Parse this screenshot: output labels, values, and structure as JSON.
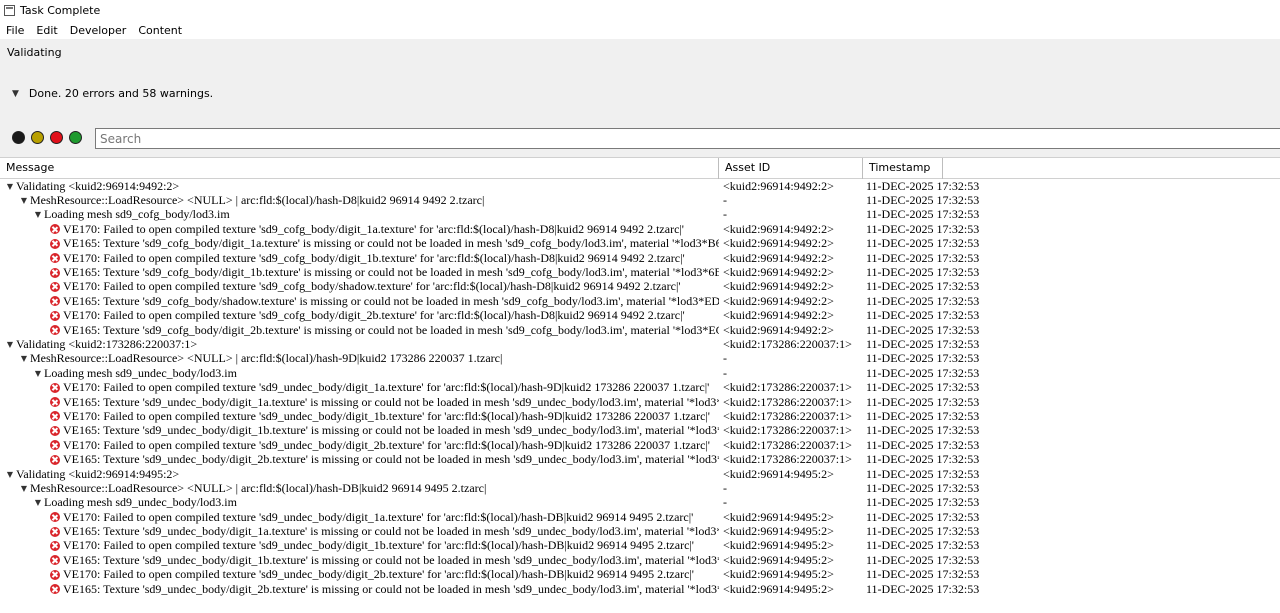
{
  "window": {
    "title": "Task Complete"
  },
  "menu": [
    "File",
    "Edit",
    "Developer",
    "Content"
  ],
  "status": {
    "label": "Validating",
    "summary": "Done. 20 errors and 58 warnings."
  },
  "filters": {
    "colors": [
      "#1a1a1a",
      "#b8a000",
      "#e0101a",
      "#1e9a2e"
    ],
    "search_placeholder": "Search"
  },
  "columns": {
    "message": "Message",
    "asset_id": "Asset ID",
    "timestamp": "Timestamp"
  },
  "rows": [
    {
      "level": 0,
      "type": "group",
      "message": "Validating <kuid2:96914:9492:2>",
      "asset": "<kuid2:96914:9492:2>",
      "time": "11-DEC-2025 17:32:53"
    },
    {
      "level": 1,
      "type": "group",
      "message": "MeshResource::LoadResource> <NULL> | arc:fld:$(local)/hash-D8|kuid2 96914 9492 2.tzarc|",
      "asset": "-",
      "time": "11-DEC-2025 17:32:53"
    },
    {
      "level": 2,
      "type": "group",
      "message": "Loading mesh sd9_cofg_body/lod3.im",
      "asset": "-",
      "time": "11-DEC-2025 17:32:53"
    },
    {
      "level": 3,
      "type": "error",
      "message": "VE170: Failed to open compiled texture 'sd9_cofg_body/digit_1a.texture' for 'arc:fld:$(local)/hash-D8|kuid2 96914 9492 2.tzarc|'",
      "asset": "<kuid2:96914:9492:2>",
      "time": "11-DEC-2025 17:32:53"
    },
    {
      "level": 3,
      "type": "error",
      "message": "VE165: Texture 'sd9_cofg_body/digit_1a.texture' is missing or could not be loaded in mesh 'sd9_cofg_body/lod3.im', material '*lod3*B64F0BB1*m...",
      "asset": "<kuid2:96914:9492:2>",
      "time": "11-DEC-2025 17:32:53"
    },
    {
      "level": 3,
      "type": "error",
      "message": "VE170: Failed to open compiled texture 'sd9_cofg_body/digit_1b.texture' for 'arc:fld:$(local)/hash-D8|kuid2 96914 9492 2.tzarc|'",
      "asset": "<kuid2:96914:9492:2>",
      "time": "11-DEC-2025 17:32:53"
    },
    {
      "level": 3,
      "type": "error",
      "message": "VE165: Texture 'sd9_cofg_body/digit_1b.texture' is missing or could not be loaded in mesh 'sd9_cofg_body/lod3.im', material '*lod3*6B0DFE96*m...",
      "asset": "<kuid2:96914:9492:2>",
      "time": "11-DEC-2025 17:32:53"
    },
    {
      "level": 3,
      "type": "error",
      "message": "VE170: Failed to open compiled texture 'sd9_cofg_body/shadow.texture' for 'arc:fld:$(local)/hash-D8|kuid2 96914 9492 2.tzarc|'",
      "asset": "<kuid2:96914:9492:2>",
      "time": "11-DEC-2025 17:32:53"
    },
    {
      "level": 3,
      "type": "error",
      "message": "VE165: Texture 'sd9_cofg_body/shadow.texture' is missing or could not be loaded in mesh 'sd9_cofg_body/lod3.im', material '*lod3*ED2D3077*mt...",
      "asset": "<kuid2:96914:9492:2>",
      "time": "11-DEC-2025 17:32:53"
    },
    {
      "level": 3,
      "type": "error",
      "message": "VE170: Failed to open compiled texture 'sd9_cofg_body/digit_2b.texture' for 'arc:fld:$(local)/hash-D8|kuid2 96914 9492 2.tzarc|'",
      "asset": "<kuid2:96914:9492:2>",
      "time": "11-DEC-2025 17:32:53"
    },
    {
      "level": 3,
      "type": "error",
      "message": "VE165: Texture 'sd9_cofg_body/digit_2b.texture' is missing or could not be loaded in mesh 'sd9_cofg_body/lod3.im', material '*lod3*EC942D3D*m...",
      "asset": "<kuid2:96914:9492:2>",
      "time": "11-DEC-2025 17:32:53"
    },
    {
      "level": 0,
      "type": "group",
      "message": "Validating <kuid2:173286:220037:1>",
      "asset": "<kuid2:173286:220037:1>",
      "time": "11-DEC-2025 17:32:53"
    },
    {
      "level": 1,
      "type": "group",
      "message": "MeshResource::LoadResource> <NULL> | arc:fld:$(local)/hash-9D|kuid2 173286 220037 1.tzarc|",
      "asset": "-",
      "time": "11-DEC-2025 17:32:53"
    },
    {
      "level": 2,
      "type": "group",
      "message": "Loading mesh sd9_undec_body/lod3.im",
      "asset": "-",
      "time": "11-DEC-2025 17:32:53"
    },
    {
      "level": 3,
      "type": "error",
      "message": "VE170: Failed to open compiled texture 'sd9_undec_body/digit_1a.texture' for 'arc:fld:$(local)/hash-9D|kuid2 173286 220037 1.tzarc|'",
      "asset": "<kuid2:173286:220037:1>",
      "time": "11-DEC-2025 17:32:53"
    },
    {
      "level": 3,
      "type": "error",
      "message": "VE165: Texture 'sd9_undec_body/digit_1a.texture' is missing or could not be loaded in mesh 'sd9_undec_body/lod3.im', material '*lod3*B64F0BB1...",
      "asset": "<kuid2:173286:220037:1>",
      "time": "11-DEC-2025 17:32:53"
    },
    {
      "level": 3,
      "type": "error",
      "message": "VE170: Failed to open compiled texture 'sd9_undec_body/digit_1b.texture' for 'arc:fld:$(local)/hash-9D|kuid2 173286 220037 1.tzarc|'",
      "asset": "<kuid2:173286:220037:1>",
      "time": "11-DEC-2025 17:32:53"
    },
    {
      "level": 3,
      "type": "error",
      "message": "VE165: Texture 'sd9_undec_body/digit_1b.texture' is missing or could not be loaded in mesh 'sd9_undec_body/lod3.im', material '*lod3*6B0DFE96...",
      "asset": "<kuid2:173286:220037:1>",
      "time": "11-DEC-2025 17:32:53"
    },
    {
      "level": 3,
      "type": "error",
      "message": "VE170: Failed to open compiled texture 'sd9_undec_body/digit_2b.texture' for 'arc:fld:$(local)/hash-9D|kuid2 173286 220037 1.tzarc|'",
      "asset": "<kuid2:173286:220037:1>",
      "time": "11-DEC-2025 17:32:53"
    },
    {
      "level": 3,
      "type": "error",
      "message": "VE165: Texture 'sd9_undec_body/digit_2b.texture' is missing or could not be loaded in mesh 'sd9_undec_body/lod3.im', material '*lod3*EC942D3...",
      "asset": "<kuid2:173286:220037:1>",
      "time": "11-DEC-2025 17:32:53"
    },
    {
      "level": 0,
      "type": "group",
      "message": "Validating <kuid2:96914:9495:2>",
      "asset": "<kuid2:96914:9495:2>",
      "time": "11-DEC-2025 17:32:53"
    },
    {
      "level": 1,
      "type": "group",
      "message": "MeshResource::LoadResource> <NULL> | arc:fld:$(local)/hash-DB|kuid2 96914 9495 2.tzarc|",
      "asset": "-",
      "time": "11-DEC-2025 17:32:53"
    },
    {
      "level": 2,
      "type": "group",
      "message": "Loading mesh sd9_undec_body/lod3.im",
      "asset": "-",
      "time": "11-DEC-2025 17:32:53"
    },
    {
      "level": 3,
      "type": "error",
      "message": "VE170: Failed to open compiled texture 'sd9_undec_body/digit_1a.texture' for 'arc:fld:$(local)/hash-DB|kuid2 96914 9495 2.tzarc|'",
      "asset": "<kuid2:96914:9495:2>",
      "time": "11-DEC-2025 17:32:53"
    },
    {
      "level": 3,
      "type": "error",
      "message": "VE165: Texture 'sd9_undec_body/digit_1a.texture' is missing or could not be loaded in mesh 'sd9_undec_body/lod3.im', material '*lod3*B64F0BB1...",
      "asset": "<kuid2:96914:9495:2>",
      "time": "11-DEC-2025 17:32:53"
    },
    {
      "level": 3,
      "type": "error",
      "message": "VE170: Failed to open compiled texture 'sd9_undec_body/digit_1b.texture' for 'arc:fld:$(local)/hash-DB|kuid2 96914 9495 2.tzarc|'",
      "asset": "<kuid2:96914:9495:2>",
      "time": "11-DEC-2025 17:32:53"
    },
    {
      "level": 3,
      "type": "error",
      "message": "VE165: Texture 'sd9_undec_body/digit_1b.texture' is missing or could not be loaded in mesh 'sd9_undec_body/lod3.im', material '*lod3*6B0DFE96...",
      "asset": "<kuid2:96914:9495:2>",
      "time": "11-DEC-2025 17:32:53"
    },
    {
      "level": 3,
      "type": "error",
      "message": "VE170: Failed to open compiled texture 'sd9_undec_body/digit_2b.texture' for 'arc:fld:$(local)/hash-DB|kuid2 96914 9495 2.tzarc|'",
      "asset": "<kuid2:96914:9495:2>",
      "time": "11-DEC-2025 17:32:53"
    },
    {
      "level": 3,
      "type": "error",
      "message": "VE165: Texture 'sd9_undec_body/digit_2b.texture' is missing or could not be loaded in mesh 'sd9_undec_body/lod3.im', material '*lod3*EC942D3...",
      "asset": "<kuid2:96914:9495:2>",
      "time": "11-DEC-2025 17:32:53"
    }
  ]
}
